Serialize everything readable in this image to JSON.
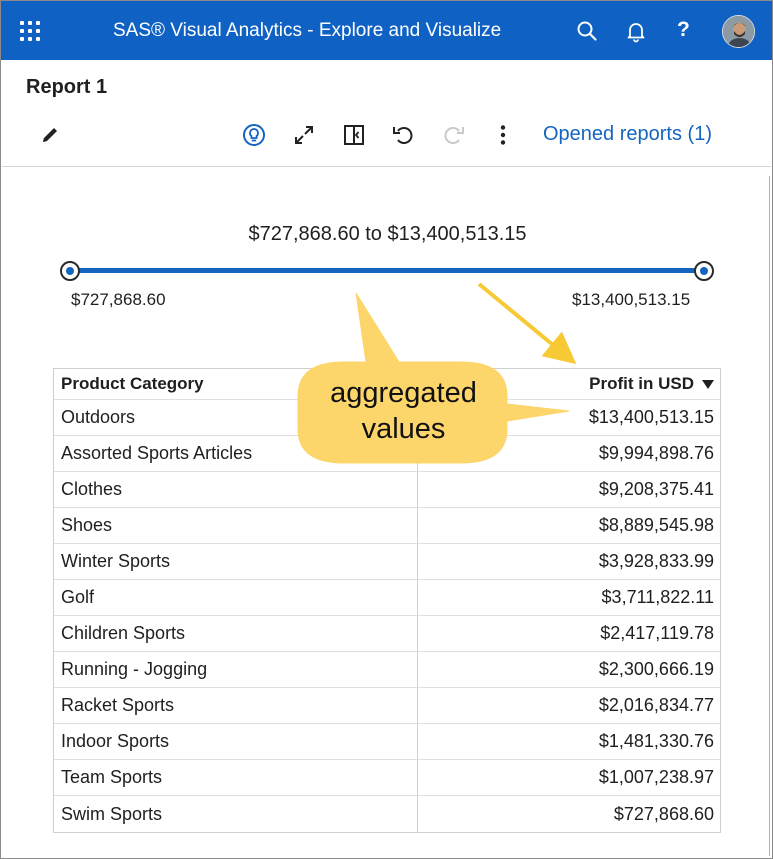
{
  "header": {
    "app_title": "SAS® Visual Analytics - Explore and Visualize",
    "help_label": "?"
  },
  "report": {
    "title": "Report 1",
    "opened_reports_label": "Opened reports (1)"
  },
  "slider": {
    "range_label": "$727,868.60 to $13,400,513.15",
    "min_label": "$727,868.60",
    "max_label": "$13,400,513.15",
    "selected_min_fraction": 0,
    "selected_max_fraction": 1
  },
  "table": {
    "columns": [
      "Product Category",
      "Profit in USD"
    ],
    "sort": "descending",
    "rows": [
      {
        "category": "Outdoors",
        "profit": "$13,400,513.15"
      },
      {
        "category": "Assorted Sports Articles",
        "profit": "$9,994,898.76"
      },
      {
        "category": "Clothes",
        "profit": "$9,208,375.41"
      },
      {
        "category": "Shoes",
        "profit": "$8,889,545.98"
      },
      {
        "category": "Winter Sports",
        "profit": "$3,928,833.99"
      },
      {
        "category": "Golf",
        "profit": "$3,711,822.11"
      },
      {
        "category": "Children Sports",
        "profit": "$2,417,119.78"
      },
      {
        "category": "Running - Jogging",
        "profit": "$2,300,666.19"
      },
      {
        "category": "Racket Sports",
        "profit": "$2,016,834.77"
      },
      {
        "category": "Indoor Sports",
        "profit": "$1,481,330.76"
      },
      {
        "category": "Team Sports",
        "profit": "$1,007,238.97"
      },
      {
        "category": "Swim Sports",
        "profit": "$727,868.60"
      }
    ]
  },
  "annotation": {
    "line1": "aggregated",
    "line2": "values"
  },
  "icons": {
    "app_menu": "apps-grid-icon",
    "search": "search-icon",
    "notifications": "bell-icon",
    "help": "help-icon",
    "edit": "pencil-icon",
    "insights": "lightbulb-icon",
    "expand": "expand-icon",
    "panel": "side-panel-icon",
    "undo": "undo-icon",
    "redo": "redo-icon",
    "more": "more-vertical-icon"
  },
  "colors": {
    "brand_blue": "#0f62c4",
    "link_blue": "#1565c0",
    "callout_fill": "#fcd56b",
    "arrow_yellow": "#f7c934"
  }
}
